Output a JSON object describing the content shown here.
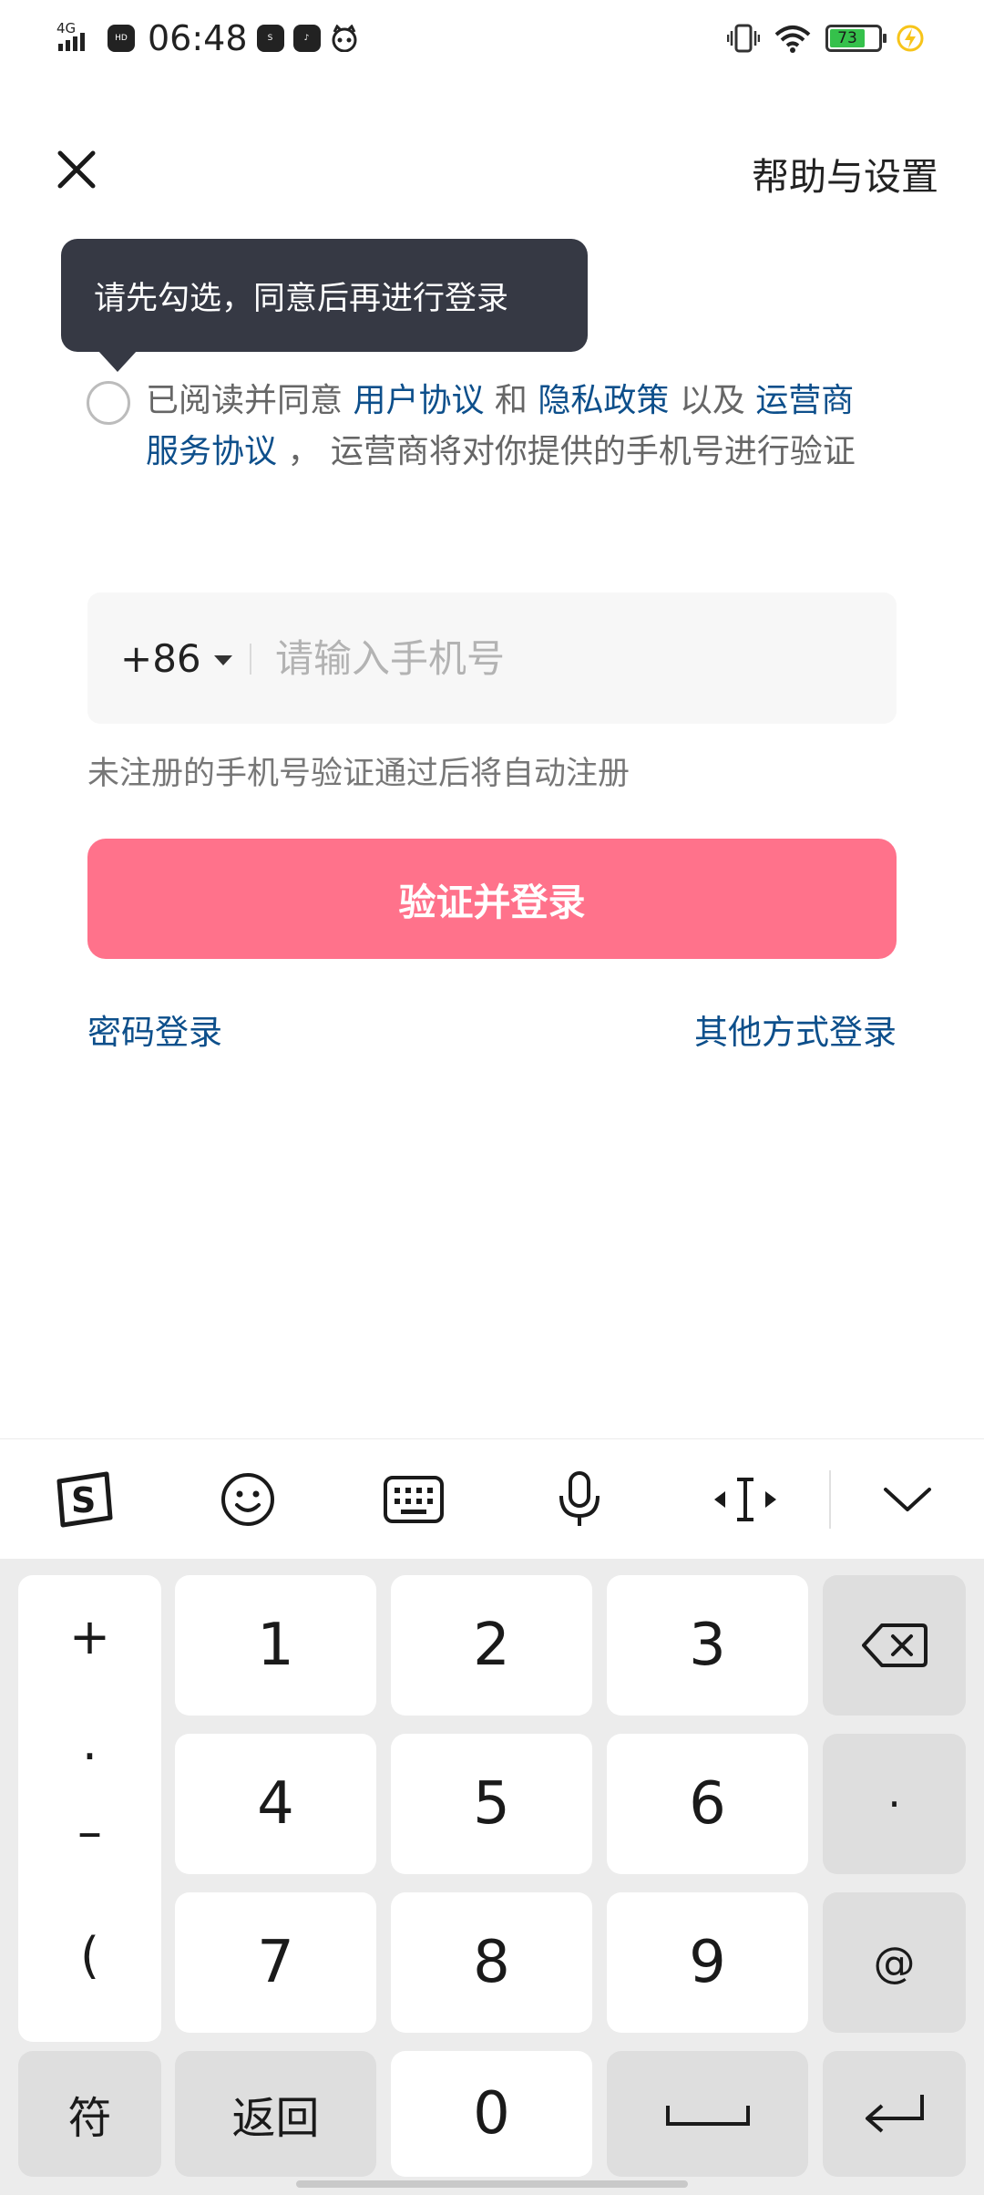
{
  "status_bar": {
    "network": "4G",
    "hd": "HD",
    "time": "06:48",
    "app_icons": [
      "soul-icon",
      "tiktok-icon",
      "cat-icon"
    ],
    "battery": "73",
    "battery_level": 73
  },
  "header": {
    "help_label": "帮助与设置"
  },
  "tooltip": {
    "text": "请先勾选，同意后再进行登录"
  },
  "agreement": {
    "prefix": "已阅读并同意 ",
    "user_agreement": "用户协议",
    "and": " 和 ",
    "privacy_policy": "隐私政策",
    "also": " 以及 ",
    "carrier_agreement": "运营商服务协议",
    "suffix": " ， 运营商将对你提供的手机号进行验证"
  },
  "phone": {
    "country_code": "+86",
    "placeholder": "请输入手机号",
    "value": ""
  },
  "hint": "未注册的手机号验证通过后将自动注册",
  "login_button": "验证并登录",
  "links": {
    "password_login": "密码登录",
    "other_login": "其他方式登录"
  },
  "keyboard": {
    "symbols": [
      "+",
      ".",
      "–",
      "("
    ],
    "rows": [
      [
        "1",
        "2",
        "3"
      ],
      [
        "4",
        "5",
        "6"
      ],
      [
        "7",
        "8",
        "9"
      ]
    ],
    "dot_key": "·",
    "at_key": "@",
    "bottom": {
      "sym": "符",
      "back": "返回",
      "zero": "0"
    }
  }
}
